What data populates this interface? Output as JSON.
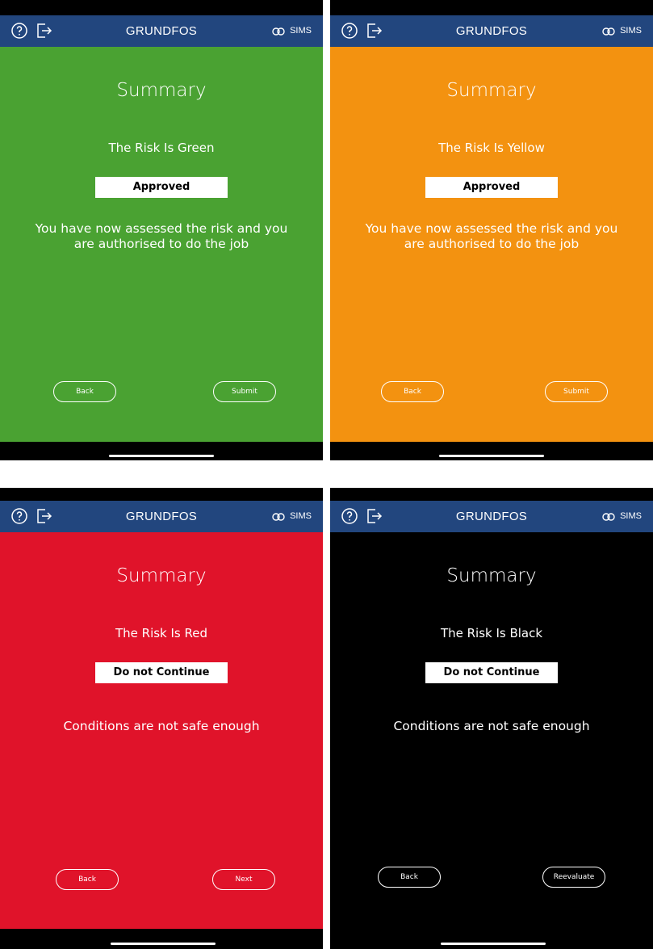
{
  "app": {
    "brand": "GRUNDFOS",
    "sims_label": "SIMS",
    "header_color": "#22467e"
  },
  "screens": [
    {
      "bg": "#4aa232",
      "title": "Summary",
      "risk": "The Risk Is Green",
      "badge": "Approved",
      "message": "You have now assessed the risk and you are authorised to do the job",
      "left_button": "Back",
      "right_button": "Submit"
    },
    {
      "bg": "#f39210",
      "title": "Summary",
      "risk": "The Risk Is Yellow",
      "badge": "Approved",
      "message": "You have now assessed the risk and you are authorised to do the job",
      "left_button": "Back",
      "right_button": "Submit"
    },
    {
      "bg": "#e0132a",
      "title": "Summary",
      "risk": "The Risk Is Red",
      "badge": "Do not Continue",
      "message": "Conditions are not safe enough",
      "left_button": "Back",
      "right_button": "Next"
    },
    {
      "bg": "#000000",
      "title": "Summary",
      "risk": "The Risk Is Black",
      "badge": "Do not Continue",
      "message": "Conditions are not safe enough",
      "left_button": "Back",
      "right_button": "Reevaluate"
    }
  ]
}
